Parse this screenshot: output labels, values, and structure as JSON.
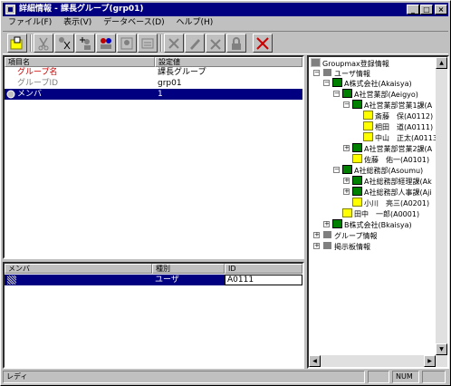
{
  "window": {
    "title": "詳細情報 - 課長グループ(grp01)"
  },
  "menu": [
    "ファイル(F)",
    "表示(V)",
    "データベース(D)",
    "ヘルプ(H)"
  ],
  "top_table": {
    "headers": [
      "項目名",
      "設定値"
    ],
    "rows": [
      {
        "name": "グループ名",
        "value": "課長グループ"
      },
      {
        "name": "グループID",
        "value": "grp01"
      },
      {
        "name": "メンバ",
        "value": "1"
      }
    ]
  },
  "bottom_table": {
    "headers": [
      "メンバ",
      "種別",
      "ID"
    ],
    "rows": [
      {
        "member": "",
        "type": "ユーザ",
        "id": "A0111"
      }
    ]
  },
  "tree": {
    "root": "Groupmax登録情報",
    "user_info": "ユーザ情報",
    "company_a": "A株式会社(Akaisya)",
    "eigyo": "A社営業部(Aeigyo)",
    "eigyo1": "A社営業部営業1課(A",
    "saito": "斎藤　保(A0112)",
    "aida": "相田　道(A0111)",
    "nakayama": "中山　正太(A0113",
    "eigyo2": "A社営業部営業2課(A",
    "sato": "佐藤　佑一(A0101)",
    "soumu": "A社総務部(Asoumu)",
    "soumu_keiri": "A社総務部経理課(Ak",
    "soumu_jinji": "A社総務部人事課(Aji",
    "ogawa": "小川　亮三(A0201)",
    "tanaka": "田中　一郎(A0001)",
    "company_b": "B株式会社(Bkaisya)",
    "group_info": "グループ情報",
    "bbs_info": "掲示板情報"
  },
  "status": {
    "text": "レディ",
    "num": "NUM"
  },
  "colors": {
    "title": "#000080",
    "highlight": "#000080",
    "red": "#cc0000",
    "link_gray": "#808080"
  }
}
